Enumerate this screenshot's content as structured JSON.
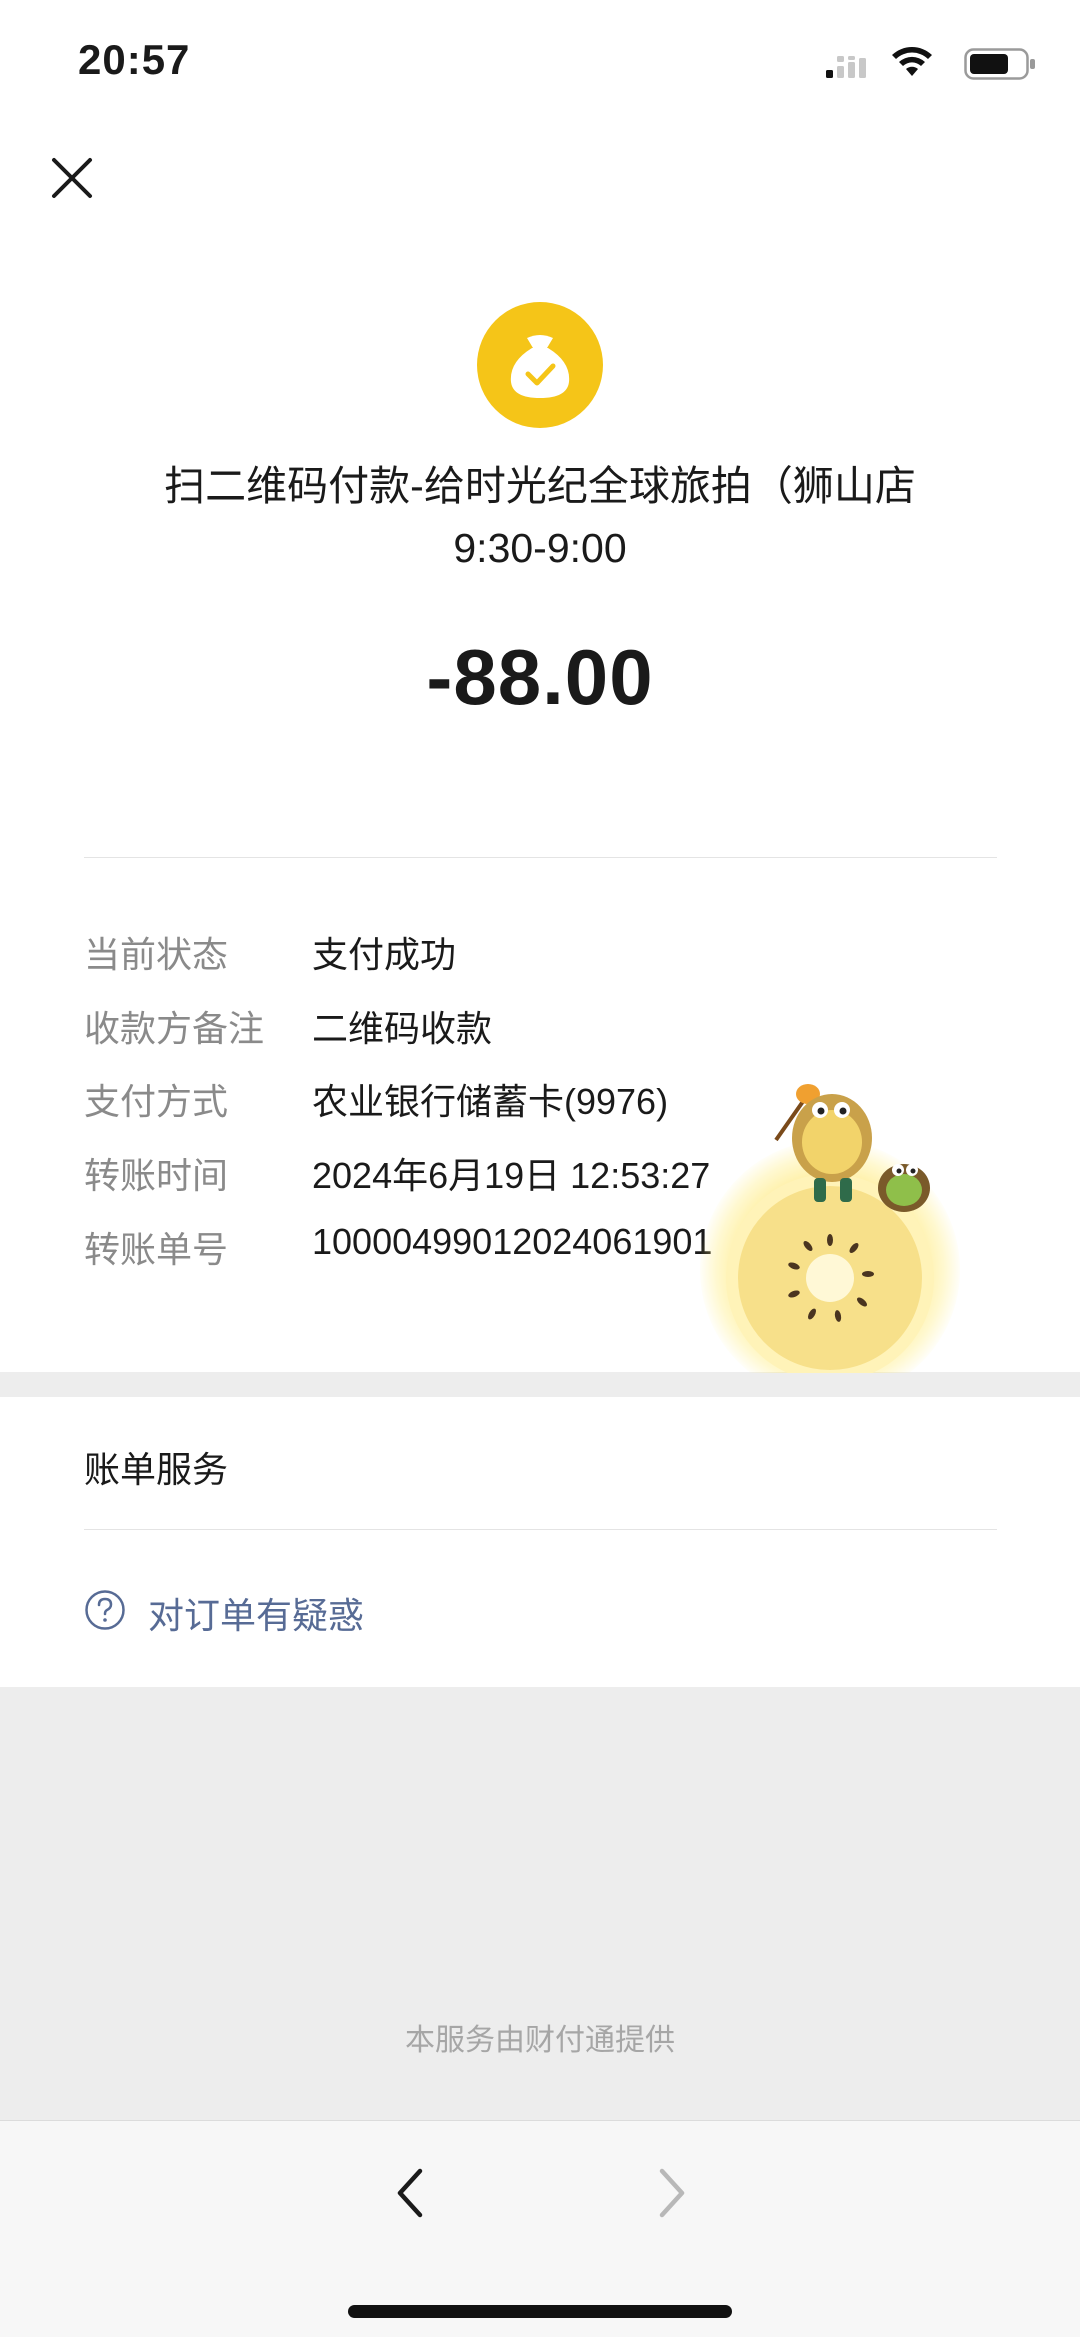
{
  "status_bar": {
    "time": "20:57"
  },
  "header": {
    "close_icon": "close-icon"
  },
  "transaction": {
    "logo_icon": "money-bag-check-icon",
    "logo_color": "#f5c518",
    "title_line1": "扫二维码付款-给时光纪全球旅拍（狮山店",
    "title_line2": "9:30-9:00",
    "amount": "-88.00"
  },
  "details": [
    {
      "label": "当前状态",
      "value": "支付成功"
    },
    {
      "label": "收款方备注",
      "value": "二维码收款"
    },
    {
      "label": "支付方式",
      "value": "农业银行储蓄卡(9976)"
    },
    {
      "label": "转账时间",
      "value": "2024年6月19日 12:53:27"
    },
    {
      "label": "转账单号",
      "value": "10000499012024061901              554"
    }
  ],
  "services": {
    "title": "账单服务",
    "question_label": "对订单有疑惑",
    "question_icon": "question-circle-icon",
    "link_color": "#576b95"
  },
  "footer": {
    "provider": "本服务由财付通提供"
  },
  "nav": {
    "back_icon": "chevron-left-icon",
    "forward_icon": "chevron-right-icon"
  }
}
